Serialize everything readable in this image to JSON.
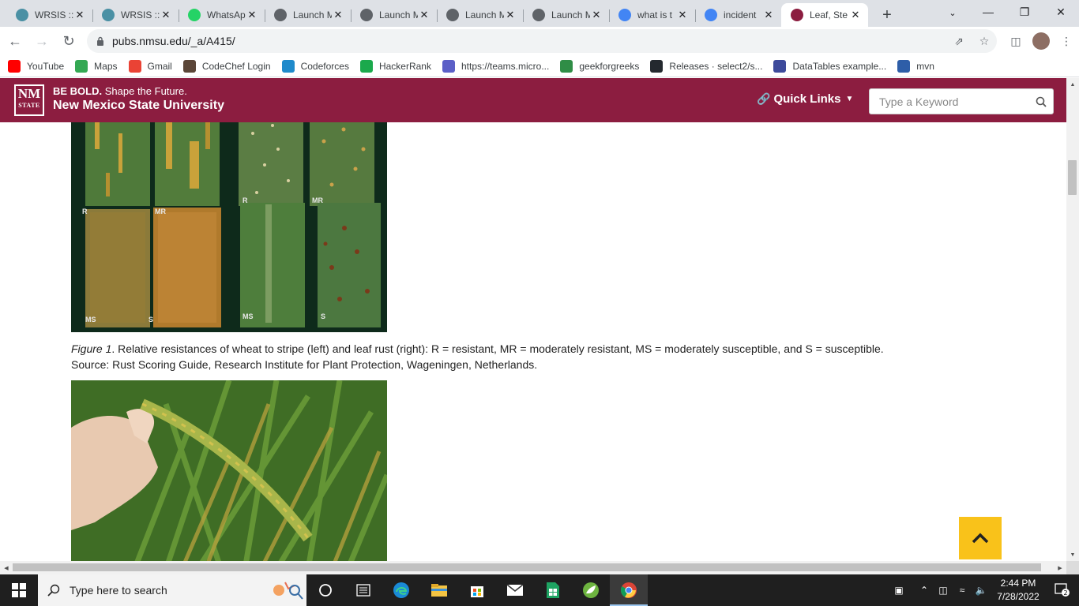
{
  "browser": {
    "tabs": [
      {
        "title": "WRSIS ::",
        "icon": "wrsis-icon",
        "color": "#4a90a4"
      },
      {
        "title": "WRSIS ::",
        "icon": "wrsis-icon",
        "color": "#4a90a4"
      },
      {
        "title": "WhatsApp",
        "icon": "whatsapp-icon",
        "color": "#25d366"
      },
      {
        "title": "Launch M",
        "icon": "globe-icon",
        "color": "#5f6368"
      },
      {
        "title": "Launch M",
        "icon": "globe-icon",
        "color": "#5f6368"
      },
      {
        "title": "Launch M",
        "icon": "globe-icon",
        "color": "#5f6368"
      },
      {
        "title": "Launch M",
        "icon": "globe-icon",
        "color": "#5f6368"
      },
      {
        "title": "what is t",
        "icon": "google-icon",
        "color": "#4285f4"
      },
      {
        "title": "incident",
        "icon": "google-icon",
        "color": "#4285f4"
      },
      {
        "title": "Leaf, Ste",
        "icon": "nmsu-icon",
        "color": "#8c1d40",
        "active": true
      }
    ],
    "url": "pubs.nmsu.edu/_a/A415/",
    "bookmarks": [
      {
        "label": "YouTube",
        "icon": "youtube-icon",
        "color": "#ff0000"
      },
      {
        "label": "Maps",
        "icon": "maps-icon",
        "color": "#34a853"
      },
      {
        "label": "Gmail",
        "icon": "gmail-icon",
        "color": "#ea4335"
      },
      {
        "label": "CodeChef Login",
        "icon": "codechef-icon",
        "color": "#5b4638"
      },
      {
        "label": "Codeforces",
        "icon": "codeforces-icon",
        "color": "#1f8acb"
      },
      {
        "label": "HackerRank",
        "icon": "hackerrank-icon",
        "color": "#1ba94c"
      },
      {
        "label": "https://teams.micro...",
        "icon": "teams-icon",
        "color": "#5b5fc7"
      },
      {
        "label": "geekforgreeks",
        "icon": "gfg-icon",
        "color": "#2f8d46"
      },
      {
        "label": "Releases · select2/s...",
        "icon": "github-icon",
        "color": "#24292f"
      },
      {
        "label": "DataTables example...",
        "icon": "datatables-icon",
        "color": "#3d4a9b"
      },
      {
        "label": "mvn",
        "icon": "maven-icon",
        "color": "#2e5ea8"
      }
    ]
  },
  "site": {
    "logo_top": "NM",
    "logo_bottom": "STATE",
    "tagline_bold": "BE BOLD.",
    "tagline_rest": " Shape the Future.",
    "university": "New Mexico State University",
    "quick_links": "Quick Links",
    "search_placeholder": "Type a Keyword"
  },
  "figure1": {
    "labels": [
      "R",
      "MR",
      "R",
      "MR",
      "MS",
      "S",
      "MS",
      "S"
    ],
    "caption_label": "Figure 1",
    "caption_text": ". Relative resistances of wheat to stripe (left) and leaf rust (right): R = resistant, MR = moderately resistant, MS = moderately susceptible, and S = susceptible.",
    "caption_source": "Source: Rust Scoring Guide, Research Institute for Plant Protection, Wageningen, Netherlands."
  },
  "taskbar": {
    "search_placeholder": "Type here to search",
    "time": "2:44 PM",
    "date": "7/28/2022",
    "notification_count": "2"
  },
  "colors": {
    "brand": "#8c1d40",
    "scroll_top_button": "#f9c21a"
  }
}
